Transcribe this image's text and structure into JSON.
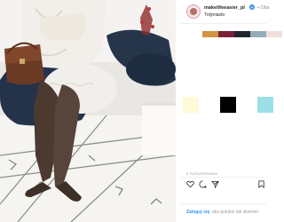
{
  "post": {
    "username": "makelifeeasier_pl",
    "follow_label": "• Obs",
    "location": "Trójmiasto",
    "date": "5 PAŹDZIERNIKA",
    "login_link": "Zaloguj się",
    "login_suffix": ", aby polubić lub skomen"
  },
  "palette": {
    "swatches": [
      "#d2943f",
      "#7a1f37",
      "#21262e",
      "#93aeb7",
      "#f1dfdd"
    ],
    "boxes": [
      "#fdfbd8",
      "#000000",
      "#9ddfe6"
    ]
  },
  "icons": {
    "avatar": "profile-avatar",
    "verified": "verified-badge-icon",
    "like": "heart-icon",
    "comment": "comment-bubble-icon",
    "share": "share-arrow-icon",
    "save": "bookmark-icon"
  }
}
